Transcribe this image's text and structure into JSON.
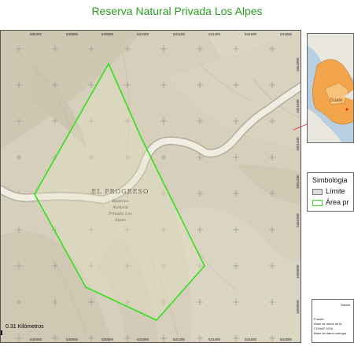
{
  "title": "Reserva Natural Privada Los Alpes",
  "map": {
    "place_label": "EL PROGRESO",
    "reserve_label_lines": [
      "Reserva",
      "Natural",
      "Privada Los",
      "Alpes"
    ],
    "scale_label": "0.31 Kilómetros",
    "x_ticks_top": [
      "530400",
      "530600",
      "530800",
      "531000",
      "531200",
      "531400",
      "531600",
      "531800"
    ],
    "x_ticks_bottom": [
      "530400",
      "530600",
      "530800",
      "531000",
      "531200",
      "531400",
      "531600",
      "531800"
    ],
    "y_ticks_right": [
      "1651800",
      "1651600",
      "1651400",
      "1651200",
      "1651000",
      "1650800",
      "1650600"
    ],
    "colors": {
      "boundary": "#33e01a",
      "terrain": "#d6d0bd",
      "road": "#f2efe6"
    }
  },
  "inset": {
    "label": "Guate"
  },
  "legend": {
    "title": "Simbologia",
    "items": [
      {
        "label": "Límite",
        "swatch": "gray"
      },
      {
        "label": "Área pr",
        "swatch": "green"
      }
    ]
  },
  "source": {
    "header": "Sistem",
    "lines": [
      "Fuente:",
      "Base de datos de la",
      "CONAP 2016",
      "Base de datos cartogra"
    ]
  }
}
